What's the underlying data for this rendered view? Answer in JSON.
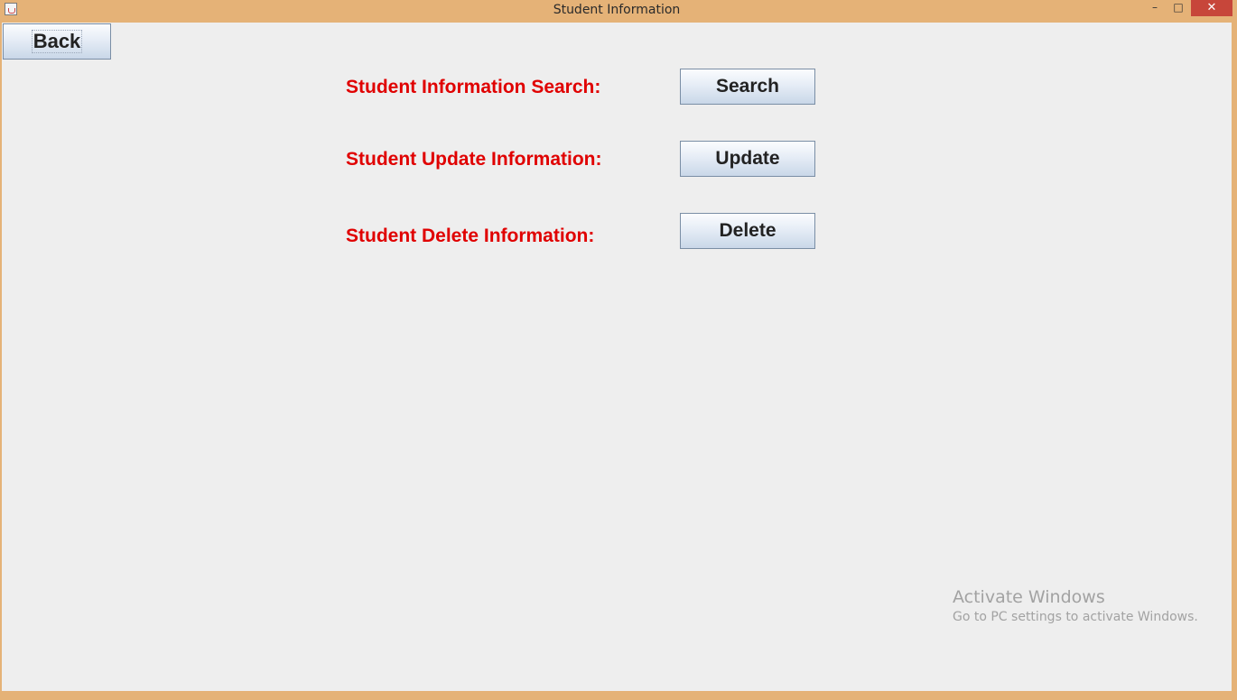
{
  "window": {
    "title": "Student Information",
    "controls": {
      "minimize": "–",
      "maximize": "□",
      "close": "✕"
    }
  },
  "toolbar": {
    "back_label": "Back"
  },
  "rows": [
    {
      "label": "Student Information Search:",
      "button": "Search"
    },
    {
      "label": "Student Update Information:",
      "button": "Update"
    },
    {
      "label": "Student Delete Information:",
      "button": "Delete"
    }
  ],
  "watermark": {
    "title": "Activate Windows",
    "subtitle": "Go to PC settings to activate Windows."
  },
  "colors": {
    "label_red": "#e00000",
    "titlebar": "#e5b277",
    "client_bg": "#eeeeee",
    "close_button": "#c7463a"
  }
}
